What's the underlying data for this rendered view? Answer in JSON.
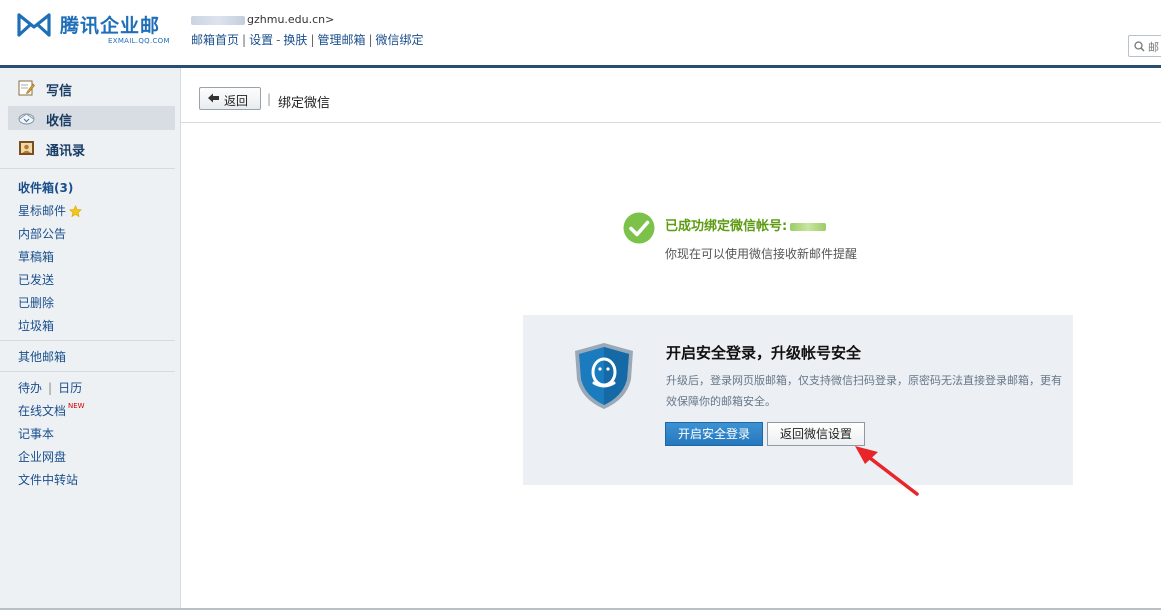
{
  "header": {
    "logo_text": "腾讯企业邮",
    "logo_sub": "EXMAIL.QQ.COM",
    "user_domain": "gzhmu.edu.cn>",
    "links": [
      "邮箱首页",
      "设置",
      "换肤",
      "管理邮箱",
      "微信绑定"
    ],
    "search_placeholder": "Q 邮"
  },
  "sidebar": {
    "write": "写信",
    "inbox": "收信",
    "contacts": "通讯录",
    "folders": {
      "inbox_count": "收件箱(3)",
      "starred": "星标邮件",
      "notice": "内部公告",
      "drafts": "草稿箱",
      "sent": "已发送",
      "deleted": "已删除",
      "spam": "垃圾箱"
    },
    "other": "其他邮箱",
    "todo": "待办",
    "calendar": "日历",
    "docs": "在线文档",
    "new_tag": "NEW",
    "notes": "记事本",
    "disk": "企业网盘",
    "transfer": "文件中转站"
  },
  "main": {
    "back_label": "返回",
    "crumb_sep": "|",
    "title": "绑定微信",
    "success_title": "已成功绑定微信帐号:",
    "success_desc": "你现在可以使用微信接收新邮件提醒",
    "promo": {
      "title": "开启安全登录，升级帐号安全",
      "desc": "升级后，登录网页版邮箱，仅支持微信扫码登录，原密码无法直接登录邮箱，更有效保障你的邮箱安全。",
      "enable_button": "开启安全登录",
      "back_wechat_button": "返回微信设置"
    }
  },
  "colors": {
    "brand": "#1f6fb8",
    "header_rule": "#2a4d72",
    "success": "#5d9b13",
    "primary_button": "#2678bd",
    "annotation_arrow": "#e8262a"
  },
  "icons": [
    "write-icon",
    "inbox-icon",
    "contacts-icon",
    "star-icon",
    "check-circle-icon",
    "qq-shield-icon",
    "back-arrow-icon",
    "search-icon"
  ]
}
